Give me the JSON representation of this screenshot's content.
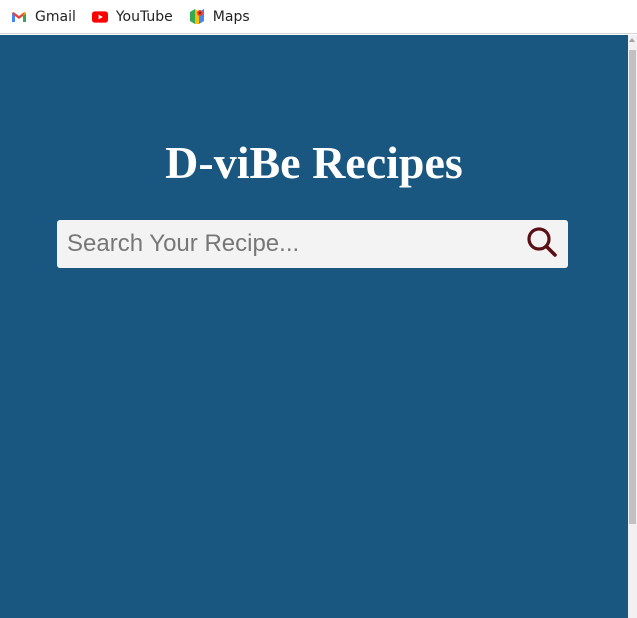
{
  "bookmarks": [
    {
      "label": "Gmail",
      "icon": "gmail-icon"
    },
    {
      "label": "YouTube",
      "icon": "youtube-icon"
    },
    {
      "label": "Maps",
      "icon": "maps-icon"
    }
  ],
  "page": {
    "title": "D-viBe Recipes",
    "background_color": "#1a5780"
  },
  "search": {
    "placeholder": "Search Your Recipe...",
    "value": "",
    "icon": "search-icon",
    "icon_color": "#5a0f14"
  }
}
